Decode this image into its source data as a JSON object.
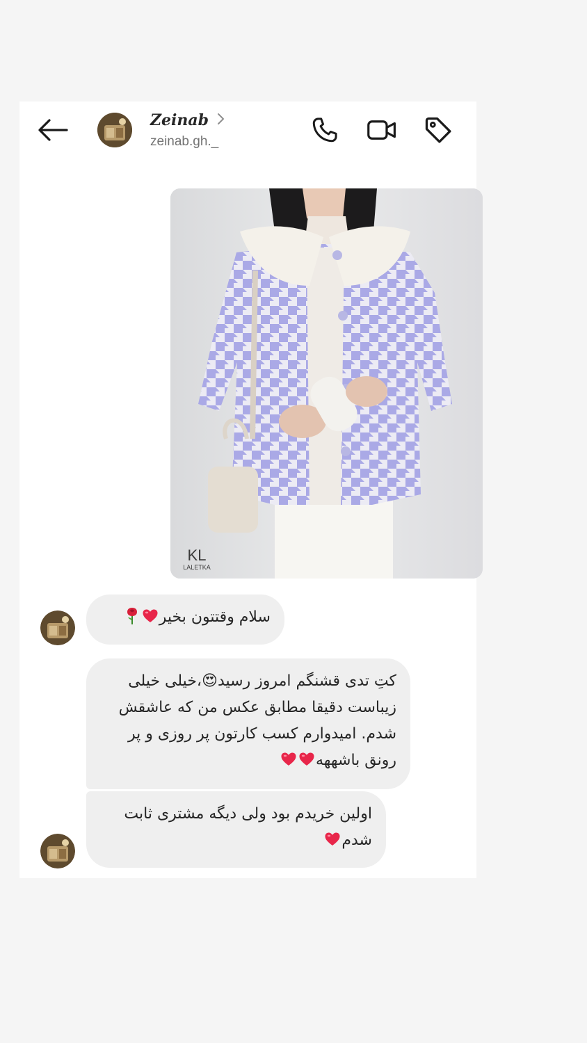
{
  "header": {
    "name": "Zeinab",
    "username": "zeinab.gh._",
    "icons": {
      "back": "arrow-left-icon",
      "call": "phone-icon",
      "video": "video-camera-icon",
      "tag": "tag-icon",
      "profile_chevron": "chevron-right-icon"
    }
  },
  "photo": {
    "brand_mark": "KL",
    "brand_name": "LALETKA",
    "jacket_color": "#a9a8e6"
  },
  "messages": [
    {
      "text": "سلام وقتتون بخیر",
      "emojis": [
        "heart",
        "rose"
      ]
    },
    {
      "text": "کتِ تدی قشنگم امروز رسید😍،خیلی خیلی زیباست دقیقا مطابق عکس من که عاشقش شدم. امیدوارم کسب کارتون پر روزی و پر رونق باشههه",
      "emojis": [
        "heart",
        "heart"
      ]
    },
    {
      "text": "اولین خریدم بود ولی دیگه مشتری ثابت شدم",
      "emojis": [
        "heart"
      ]
    }
  ],
  "colors": {
    "bubble": "#efefef",
    "text": "#262626",
    "heart": "#e8264a"
  }
}
